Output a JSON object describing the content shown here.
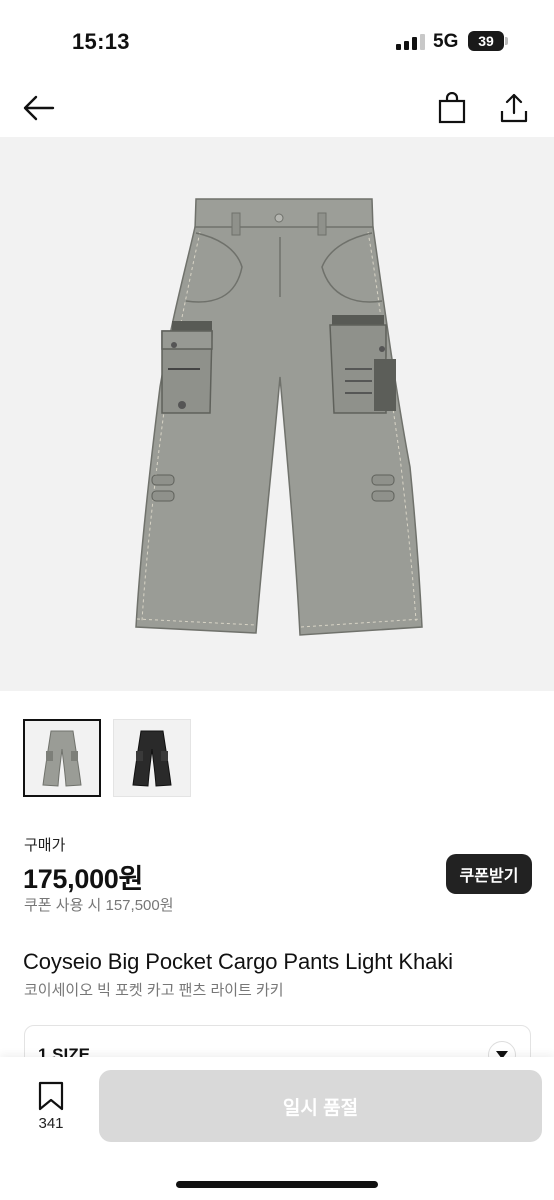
{
  "status_bar": {
    "time": "15:13",
    "network": "5G",
    "battery": "39"
  },
  "nav": {
    "back_icon": "arrow-left-icon",
    "cart_icon": "shopping-bag-icon",
    "share_icon": "share-icon"
  },
  "gallery": {
    "thumbnails": [
      {
        "color": "#9a9c96",
        "selected": true
      },
      {
        "color": "#2a2a2a",
        "selected": false
      }
    ]
  },
  "pricing": {
    "label": "구매가",
    "price": "175,000원",
    "coupon_price": "쿠폰 사용 시 157,500원",
    "coupon_button": "쿠폰받기"
  },
  "product": {
    "name_en": "Coyseio Big Pocket Cargo Pants Light Khaki",
    "name_ko": "코이세이오 빅 포켓 카고 팬츠 라이트 카키"
  },
  "size_select": {
    "value": "1 SIZE"
  },
  "bottom_bar": {
    "wish_count": "341",
    "cta_label": "일시 품절"
  },
  "colors": {
    "pants_khaki": "#9a9c96",
    "pants_dark": "#2a2a2a",
    "disabled_button": "#d9d9d9",
    "coupon_button": "#222222"
  }
}
